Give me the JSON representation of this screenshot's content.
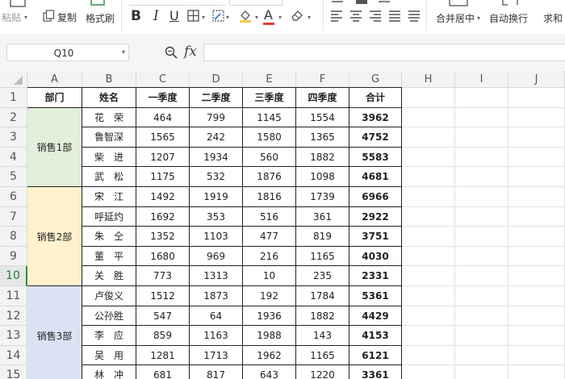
{
  "ribbon": {
    "paste_label": "粘贴",
    "copy_label": "复制",
    "format_painter_label": "格式刷",
    "bold_label": "B",
    "italic_label": "I",
    "underline_label": "U",
    "font_color_label": "A",
    "merge_center_label": "合并居中",
    "wrap_text_label": "自动换行",
    "sum_label": "求和"
  },
  "formula_bar": {
    "name_box": "Q10",
    "fx_label": "fx",
    "content": ""
  },
  "columns": [
    "A",
    "B",
    "C",
    "D",
    "E",
    "F",
    "G",
    "H",
    "I",
    "J"
  ],
  "active_row": 10,
  "table": {
    "headers": [
      "部门",
      "姓名",
      "一季度",
      "二季度",
      "三季度",
      "四季度",
      "合计"
    ],
    "departments": [
      {
        "name": "销售1部",
        "color": "#e2efda"
      },
      {
        "name": "销售2部",
        "color": "#fff2cc"
      },
      {
        "name": "销售3部",
        "color": "#dae3f3"
      }
    ],
    "rows": [
      {
        "name": "花　荣",
        "q1": "464",
        "q2": "799",
        "q3": "1145",
        "q4": "1554",
        "total": "3962"
      },
      {
        "name": "鲁智深",
        "q1": "1565",
        "q2": "242",
        "q3": "1580",
        "q4": "1365",
        "total": "4752"
      },
      {
        "name": "柴　进",
        "q1": "1207",
        "q2": "1934",
        "q3": "560",
        "q4": "1882",
        "total": "5583"
      },
      {
        "name": "武　松",
        "q1": "1175",
        "q2": "532",
        "q3": "1876",
        "q4": "1098",
        "total": "4681"
      },
      {
        "name": "宋　江",
        "q1": "1492",
        "q2": "1919",
        "q3": "1816",
        "q4": "1739",
        "total": "6966"
      },
      {
        "name": "呼延灼",
        "q1": "1692",
        "q2": "353",
        "q3": "516",
        "q4": "361",
        "total": "2922"
      },
      {
        "name": "朱　仝",
        "q1": "1352",
        "q2": "1103",
        "q3": "477",
        "q4": "819",
        "total": "3751"
      },
      {
        "name": "董　平",
        "q1": "1680",
        "q2": "969",
        "q3": "216",
        "q4": "1165",
        "total": "4030"
      },
      {
        "name": "关　胜",
        "q1": "773",
        "q2": "1313",
        "q3": "10",
        "q4": "235",
        "total": "2331"
      },
      {
        "name": "卢俊义",
        "q1": "1512",
        "q2": "1873",
        "q3": "192",
        "q4": "1784",
        "total": "5361"
      },
      {
        "name": "公孙胜",
        "q1": "547",
        "q2": "64",
        "q3": "1936",
        "q4": "1882",
        "total": "4429"
      },
      {
        "name": "李　应",
        "q1": "859",
        "q2": "1163",
        "q3": "1988",
        "q4": "143",
        "total": "4153"
      },
      {
        "name": "吴　用",
        "q1": "1281",
        "q2": "1713",
        "q3": "1962",
        "q4": "1165",
        "total": "6121"
      },
      {
        "name": "林　冲",
        "q1": "681",
        "q2": "817",
        "q3": "643",
        "q4": "1220",
        "total": "3361"
      }
    ]
  }
}
